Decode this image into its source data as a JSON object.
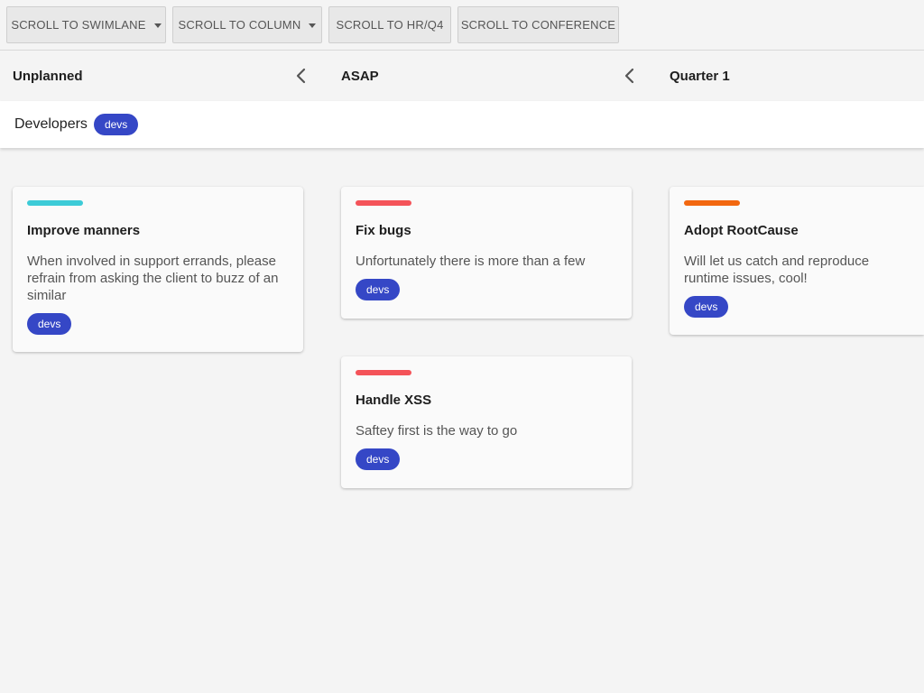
{
  "toolbar": {
    "swimlane_label": "SCROLL TO SWIMLANE",
    "column_label": "SCROLL TO COLUMN",
    "hrq4_label": "SCROLL TO HR/Q4",
    "conference_label": "SCROLL TO CONFERENCE"
  },
  "columns": [
    {
      "title": "Unplanned"
    },
    {
      "title": "ASAP"
    },
    {
      "title": "Quarter 1"
    }
  ],
  "icons": {
    "collapse": "chevron-left-icon",
    "dropdown": "caret-down-icon"
  },
  "swimlane": {
    "title": "Developers",
    "tag": "devs"
  },
  "cards": [
    {
      "title": "Improve manners",
      "description": "When involved in support errands, please refrain from asking the client to buzz of an similar",
      "tag": "devs",
      "color": "#3ccbd7"
    },
    {
      "title": "Fix bugs",
      "description": "Unfortunately there is more than a few",
      "tag": "devs",
      "color": "#f45359"
    },
    {
      "title": "Handle XSS",
      "description": "Saftey first is the way to go",
      "tag": "devs",
      "color": "#f45359"
    },
    {
      "title": "Adopt RootCause",
      "description": "Will let us catch and reproduce runtime issues, cool!",
      "tag": "devs",
      "color": "#f2670f"
    }
  ],
  "colors": {
    "tag": "#3547c6",
    "background": "#f4f4f4",
    "card": "#fafafa"
  }
}
